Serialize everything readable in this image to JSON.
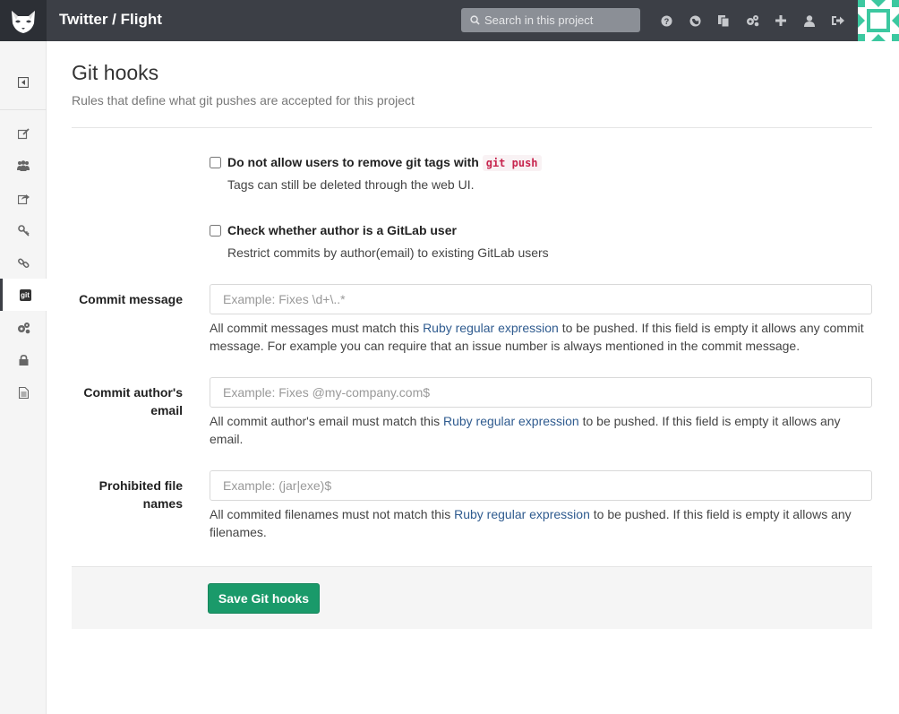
{
  "header": {
    "title": "Twitter / Flight",
    "search_placeholder": "Search in this project",
    "icons": [
      "help-icon",
      "globe-icon",
      "copy-icon",
      "cogs-icon",
      "plus-icon",
      "user-icon",
      "sign-out-icon"
    ]
  },
  "sidebar": {
    "items": [
      "toggle-sidebar-icon",
      "edit-icon",
      "users-icon",
      "share-icon",
      "key-icon",
      "link-icon",
      "git-icon",
      "cogs-icon",
      "lock-icon",
      "file-icon"
    ],
    "git_label": "git",
    "active": "git-icon"
  },
  "page": {
    "title": "Git hooks",
    "subtitle": "Rules that define what git pushes are accepted for this project"
  },
  "checkboxes": [
    {
      "label": "Do not allow users to remove git tags with",
      "code": "git push",
      "help": "Tags can still be deleted through the web UI.",
      "checked": false
    },
    {
      "label": "Check whether author is a GitLab user",
      "help": "Restrict commits by author(email) to existing GitLab users",
      "checked": false
    }
  ],
  "fields": {
    "commit_message": {
      "label": "Commit message",
      "placeholder": "Example: Fixes \\d+\\..*",
      "value": "",
      "help_pre": "All commit messages must match this ",
      "help_link": "Ruby regular expression",
      "help_post": " to be pushed. If this field is empty it allows any commit message. For example you can require that an issue number is always mentioned in the commit message."
    },
    "author_email": {
      "label_line1": "Commit author's",
      "label_line2": "email",
      "placeholder": "Example: Fixes @my-company.com$",
      "value": "",
      "help_pre": "All commit author's email must match this ",
      "help_link": "Ruby regular expression",
      "help_post": " to be pushed. If this field is empty it allows any email."
    },
    "file_names": {
      "label_line1": "Prohibited file",
      "label_line2": "names",
      "placeholder": "Example: (jar|exe)$",
      "value": "",
      "help_pre": "All commited filenames must not match this ",
      "help_link": "Ruby regular expression",
      "help_post": " to be pushed. If this field is empty it allows any filenames."
    }
  },
  "footer": {
    "save_label": "Save Git hooks"
  },
  "colors": {
    "header_bg": "#3c3f46",
    "save_button": "#1a9a6a",
    "link": "#2f5b8f",
    "code_text": "#c7254e"
  }
}
